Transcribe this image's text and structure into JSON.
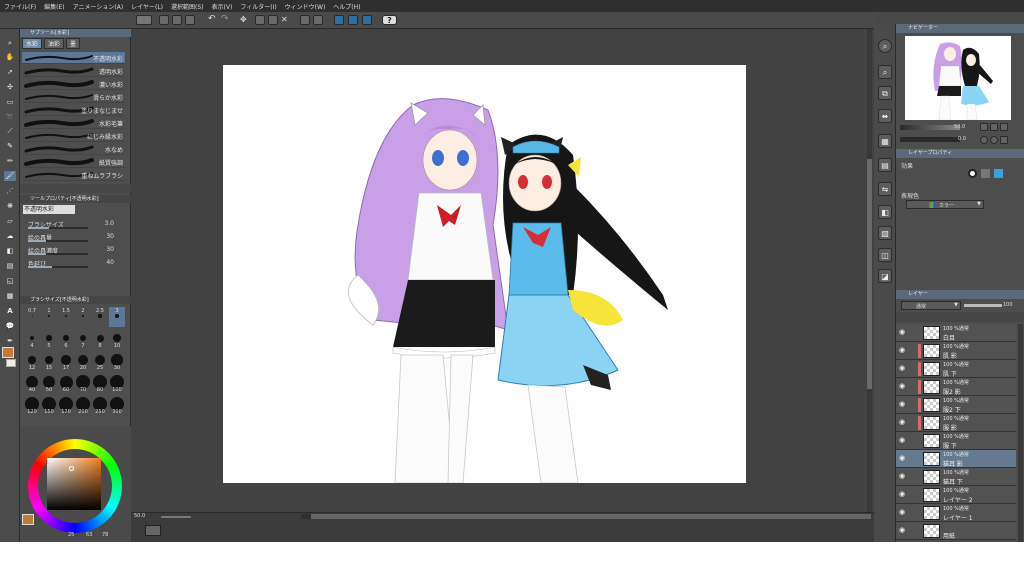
{
  "menu": [
    "ファイル(F)",
    "編集(E)",
    "アニメーション(A)",
    "レイヤー(L)",
    "選択範囲(S)",
    "表示(V)",
    "フィルター(I)",
    "ウィンドウ(W)",
    "ヘルプ(H)"
  ],
  "subtool": {
    "panel_title": "サブツール[水彩]",
    "tabs": [
      "水彩",
      "油彩",
      "墨"
    ],
    "brushes": [
      "不透明水彩",
      "透明水彩",
      "濃い水彩",
      "滑らか水彩",
      "塗りまなじませ",
      "水彩毛筆",
      "にじみ縁水彩",
      "水なめ",
      "紙質強調",
      "重ねムラブラシ"
    ],
    "selected_index": 0
  },
  "tool_property": {
    "panel_title": "ツールプロパティ[不透明水彩]",
    "brush_name": "不透明水彩",
    "rows": [
      {
        "label": "ブラシサイズ",
        "value": "3.0",
        "level": 0.35
      },
      {
        "label": "絵の具量",
        "value": "30",
        "level": 0.3
      },
      {
        "label": "絵の具濃度",
        "value": "30",
        "level": 0.3
      },
      {
        "label": "色延び",
        "value": "40",
        "level": 0.4
      }
    ]
  },
  "brush_size": {
    "panel_title": "ブラシサイズ[不透明水彩]",
    "sizes": [
      "0.7",
      "1",
      "1.5",
      "2",
      "2.5",
      "3",
      "4",
      "5",
      "6",
      "7",
      "8",
      "10",
      "12",
      "15",
      "17",
      "20",
      "25",
      "30",
      "40",
      "50",
      "60",
      "70",
      "80",
      "100",
      "120",
      "150",
      "170",
      "200",
      "250",
      "300"
    ],
    "selected": "3"
  },
  "color": {
    "main_color": "#c07a3c",
    "sub_color": "#f2ede4",
    "values": [
      "25",
      "63",
      "78"
    ]
  },
  "navigator": {
    "panel_title": "ナビゲーター",
    "zoom": "50.0",
    "angle": "0.0"
  },
  "layer_property": {
    "panel_title": "レイヤープロパティ",
    "effect_label": "効果",
    "expression_label": "表現色",
    "expression_value": "カラー"
  },
  "layers_panel": {
    "panel_title": "レイヤー",
    "blend_mode": "通常",
    "opacity": "100",
    "layers": [
      {
        "mode": "100 %通常",
        "name": "白目",
        "marked": false,
        "selected": false
      },
      {
        "mode": "100 %通常",
        "name": "肌 影",
        "marked": true,
        "selected": false
      },
      {
        "mode": "100 %通常",
        "name": "肌 下",
        "marked": true,
        "selected": false
      },
      {
        "mode": "100 %通常",
        "name": "服2 影",
        "marked": true,
        "selected": false
      },
      {
        "mode": "100 %通常",
        "name": "服2 下",
        "marked": true,
        "selected": false
      },
      {
        "mode": "100 %通常",
        "name": "服 影",
        "marked": true,
        "selected": false
      },
      {
        "mode": "100 %通常",
        "name": "服 下",
        "marked": false,
        "selected": false
      },
      {
        "mode": "100 %通常",
        "name": "猫耳 影",
        "marked": false,
        "selected": true
      },
      {
        "mode": "100 %通常",
        "name": "猫耳 下",
        "marked": false,
        "selected": false
      },
      {
        "mode": "100 %通常",
        "name": "レイヤー 2",
        "marked": false,
        "selected": false
      },
      {
        "mode": "100 %通常",
        "name": "レイヤー 1",
        "marked": false,
        "selected": false
      },
      {
        "mode": "",
        "name": "用紙",
        "marked": false,
        "selected": false
      }
    ]
  },
  "canvas": {
    "zoom": "50.0"
  }
}
